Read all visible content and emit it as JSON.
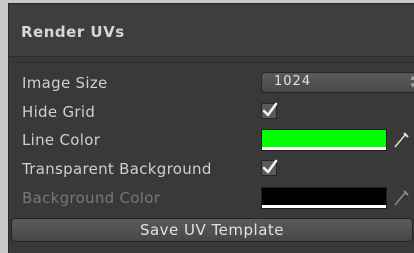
{
  "panel": {
    "title": "Render UVs",
    "fields": {
      "image_size": {
        "label": "Image Size",
        "value": "1024"
      },
      "hide_grid": {
        "label": "Hide Grid",
        "checked": true
      },
      "line_color": {
        "label": "Line Color",
        "color": "#00ff00",
        "alpha_color": "#ffffff"
      },
      "transparent_background": {
        "label": "Transparent Background",
        "checked": true
      },
      "background_color": {
        "label": "Background Color",
        "color": "#000000",
        "alpha_color": "#ffffff",
        "disabled": true
      }
    },
    "save_button_label": "Save UV Template"
  },
  "icons": {
    "dropdown": "dropdown-arrows-icon",
    "check": "checkmark-icon",
    "picker": "eyedropper-icon"
  }
}
